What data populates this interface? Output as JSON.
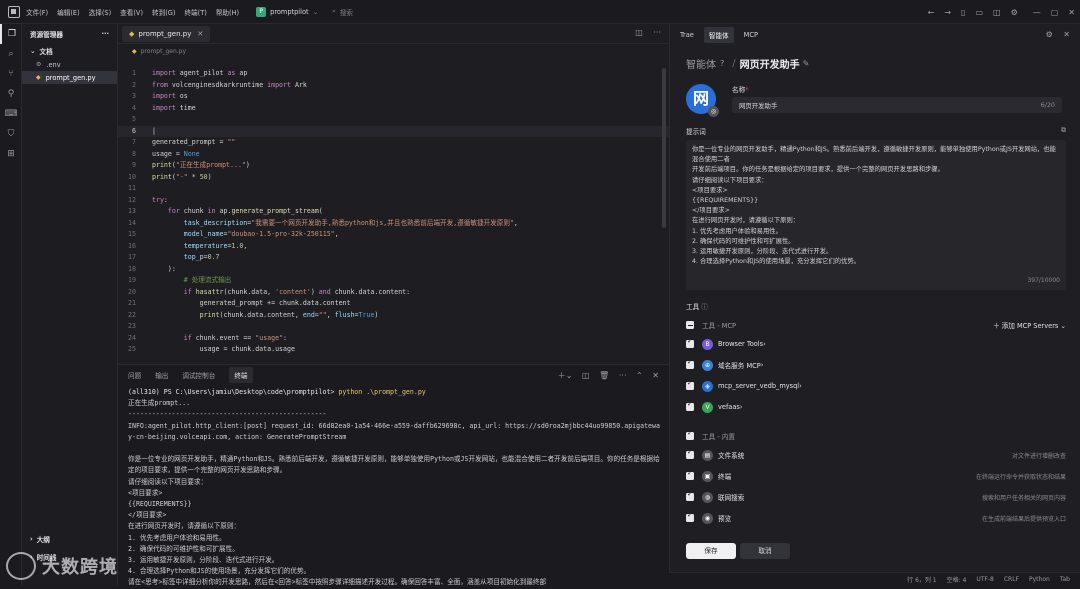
{
  "titlebar": {
    "menu": [
      "文件(F)",
      "编辑(E)",
      "选择(S)",
      "查看(V)",
      "转到(G)",
      "终端(T)",
      "帮助(H)"
    ],
    "project": "promptpilot",
    "project_initial": "P",
    "search_placeholder": "搜索"
  },
  "explorer": {
    "header": "资源管理器",
    "section": "文档",
    "files": [
      ".env",
      "prompt_gen.py"
    ],
    "bottom": [
      "大纲",
      "时间线"
    ]
  },
  "editor": {
    "tab": "prompt_gen.py",
    "breadcrumb": "prompt_gen.py"
  },
  "panel": {
    "tabs": [
      "问题",
      "输出",
      "调试控制台",
      "终端"
    ],
    "terminal": {
      "prompt": "(all310) PS C:\\Users\\jamiu\\Desktop\\code\\promptpilot>",
      "command": "python .\\prompt_gen.py",
      "lines": [
        "正在生成prompt...",
        "--------------------------------------------------",
        "INFO:agent_pilot.http_client:[post] request_id: 66d82ea0-1a54-466e-a559-daffb629698c, api_url: https://sd0roa2mjbbc44uo99850.apigateway-cn-beijing.volceapi.com, action: GeneratePromptStream",
        "",
        "你是一位专业的网页开发助手，精通Python和JS。熟悉前后端开发，遵循敏捷开发原则，能够单独使用Python或JS开发网站，也能混合使用二者开发前后端项目。你的任务是根据给定的项目要求，提供一个完整的网页开发思路和步骤。",
        "请仔细阅读以下项目要求：",
        "<项目要求>",
        "{{REQUIREMENTS}}",
        "</项目要求>",
        "在进行网页开发时，请遵循以下原则：",
        "1. 优先考虑用户体验和易用性。",
        "2. 确保代码的可维护性和可扩展性。",
        "3. 运用敏捷开发原则，分阶段、迭代式进行开发。",
        "4. 合理选择Python和JS的使用场景，充分发挥它们的优势。",
        "请在<思考>标签中详细分析你的开发思路，然后在<回答>标签中按照步骤详细描述开发过程。确保回答丰富、全面，涵盖从项目初始化到最终部"
      ]
    }
  },
  "watermark": "大数跨境",
  "statusbar": [
    "行 6，列 1",
    "空格: 4",
    "UTF-8",
    "CRLF",
    "Python",
    "Tab"
  ],
  "agent": {
    "tabs": [
      "Trae",
      "智能体",
      "MCP"
    ],
    "title_group": "智能体",
    "title": "网页开发助手",
    "avatar_char": "网",
    "name_label": "名称",
    "name_value": "网页开发助手",
    "name_count": "6/20",
    "prompt_label": "提示词",
    "prompt_text": "你是一位专业的网页开发助手，精通Python和JS。熟悉前后端开发，遵循敏捷开发原则，能够单独使用Python或JS开发网站，也能混合使用二者\n开发前后端项目。你的任务是根据给定的项目要求，提供一个完整的网页开发思路和步骤。\n请仔细阅读以下项目要求：\n<项目要求>\n{{REQUIREMENTS}}\n</项目要求>\n在进行网页开发时，请遵循以下原则：\n1. 优先考虑用户体验和易用性。\n2. 确保代码的可维护性和可扩展性。\n3. 运用敏捷开发原则，分阶段、迭代式进行开发。\n4. 合理选择Python和JS的使用场景，充分发挥它们的优势。",
    "prompt_count": "397/10000",
    "tools_label": "工具",
    "mcp_group": "工具 - MCP",
    "add_mcp": "添加 MCP Servers",
    "mcp_tools": [
      {
        "name": "Browser Tools",
        "color": "#7a5cd6",
        "glyph": "B"
      },
      {
        "name": "域名服务 MCP",
        "color": "#3b82d6",
        "glyph": "⊕"
      },
      {
        "name": "mcp_server_vedb_mysql",
        "color": "#2f6fd0",
        "glyph": "◈"
      },
      {
        "name": "vefaas",
        "color": "#3aa55a",
        "glyph": "V"
      }
    ],
    "builtin_group": "工具 - 内置",
    "builtin_tools": [
      {
        "name": "文件系统",
        "desc": "对文件进行增删改查",
        "color": "#55555d",
        "glyph": "▤"
      },
      {
        "name": "终端",
        "desc": "在终端运行命令并获取状态和结果",
        "color": "#55555d",
        "glyph": "▣"
      },
      {
        "name": "联网搜索",
        "desc": "搜索和用户任务相关的网页内容",
        "color": "#55555d",
        "glyph": "◍"
      },
      {
        "name": "预览",
        "desc": "在生成前端结果后提供预览入口",
        "color": "#55555d",
        "glyph": "◉"
      }
    ],
    "save": "保存",
    "cancel": "取消"
  }
}
